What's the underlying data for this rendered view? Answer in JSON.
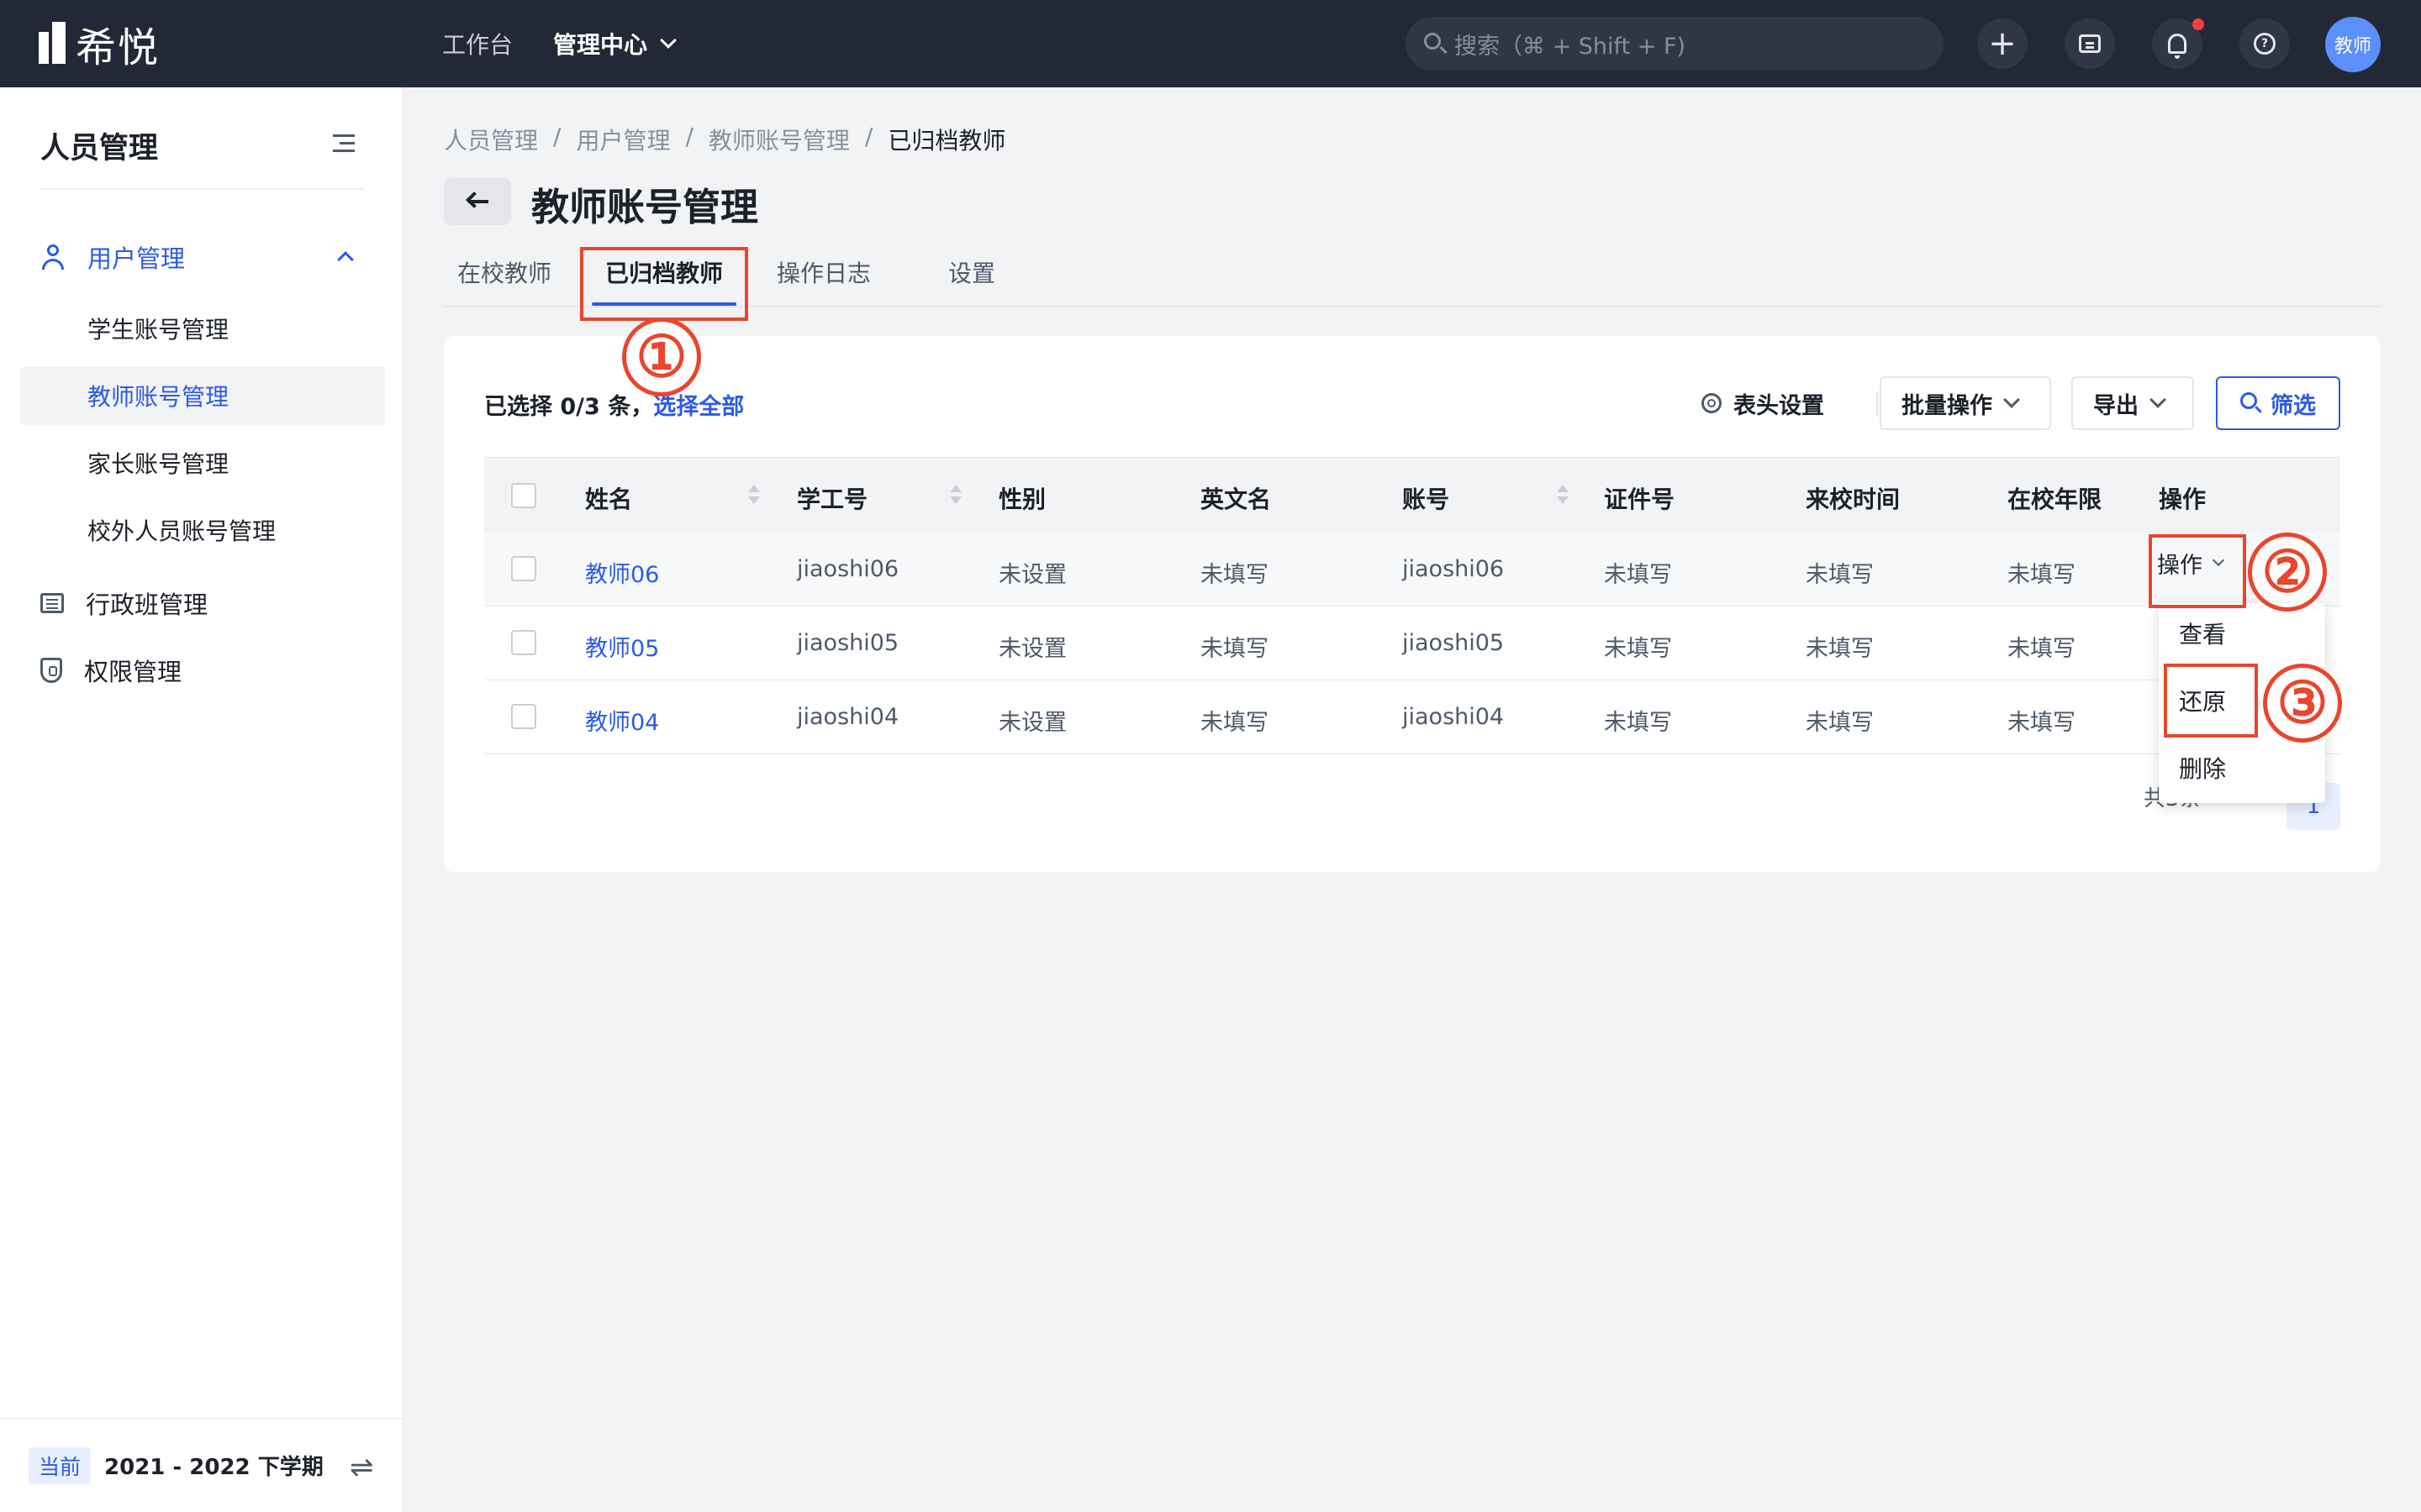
{
  "topbar": {
    "logo_text": "希悦",
    "nav": [
      "工作台",
      "管理中心"
    ],
    "search_placeholder": "搜索（⌘ + Shift + F)",
    "plus_icon": "+",
    "avatar_text": "教师"
  },
  "sidebar": {
    "title": "人员管理",
    "group_label": "用户管理",
    "sub_items": [
      "学生账号管理",
      "教师账号管理",
      "家长账号管理",
      "校外人员账号管理"
    ],
    "items": [
      "行政班管理",
      "权限管理"
    ],
    "footer_badge": "当前",
    "footer_term": "2021 - 2022 下学期",
    "swap_icon": "⇌"
  },
  "breadcrumb": [
    "人员管理",
    "用户管理",
    "教师账号管理",
    "已归档教师"
  ],
  "breadcrumb_sep": "/",
  "page_title": "教师账号管理",
  "tabs": [
    "在校教师",
    "已归档教师",
    "操作日志",
    "设置"
  ],
  "toolbar": {
    "selected_text": "已选择 0/3 条，",
    "select_all": "选择全部",
    "header_settings": "表头设置",
    "batch": "批量操作",
    "export": "导出",
    "filter": "筛选"
  },
  "table": {
    "columns": [
      "姓名",
      "学工号",
      "性别",
      "英文名",
      "账号",
      "证件号",
      "来校时间",
      "在校年限",
      "操作"
    ],
    "rows": [
      [
        "教师06",
        "jiaoshi06",
        "未设置",
        "未填写",
        "jiaoshi06",
        "未填写",
        "未填写",
        "未填写"
      ],
      [
        "教师05",
        "jiaoshi05",
        "未设置",
        "未填写",
        "jiaoshi05",
        "未填写",
        "未填写",
        "未填写"
      ],
      [
        "教师04",
        "jiaoshi04",
        "未设置",
        "未填写",
        "jiaoshi04",
        "未填写",
        "未填写",
        "未填写"
      ]
    ],
    "row_action": "操作"
  },
  "dropdown": [
    "查看",
    "还原",
    "删除"
  ],
  "pagination": {
    "total": "共3条",
    "page": "1"
  },
  "annotations": [
    "①",
    "②",
    "③"
  ],
  "colors": {
    "accent": "#2c5ae8",
    "topbar": "#222835",
    "annotation": "#e8462d"
  }
}
